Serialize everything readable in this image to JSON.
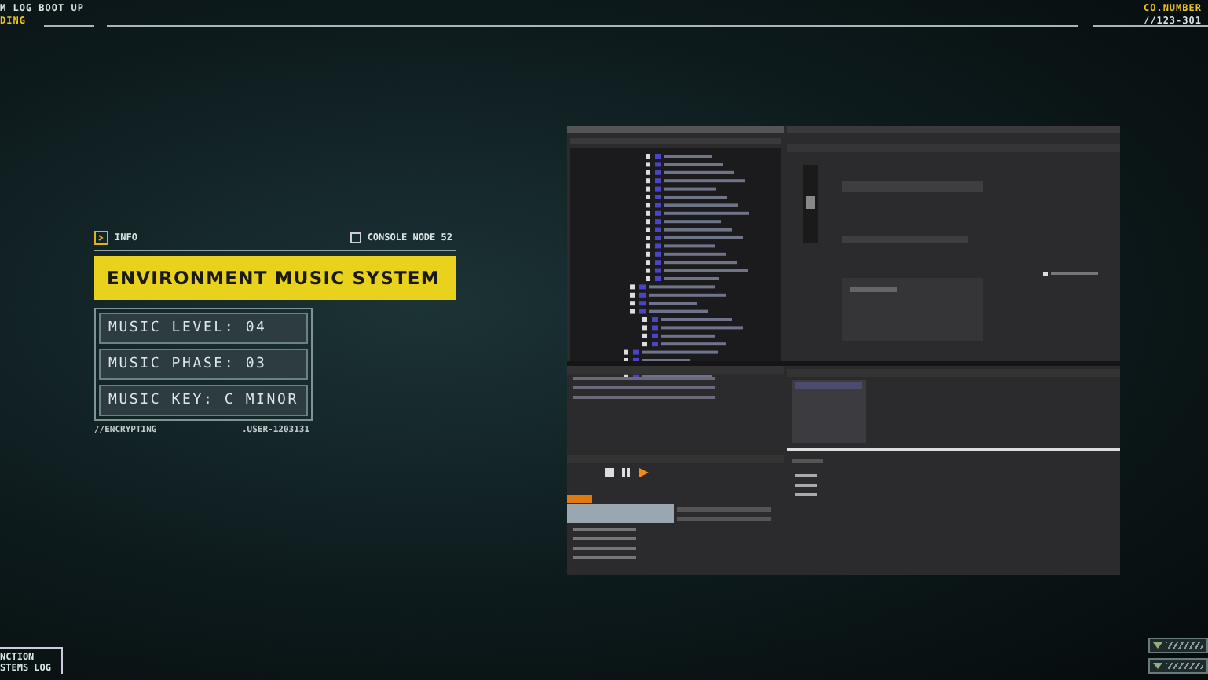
{
  "top_bar": {
    "left_lines": [
      "M LOG BOOT UP",
      "DING"
    ],
    "right_lines": [
      "CO.NUMBER",
      "//123-301"
    ]
  },
  "info_panel": {
    "tag": "INFO",
    "node": "CONSOLE NODE 52",
    "title": "ENVIRONMENT MUSIC SYSTEM",
    "rows": [
      "MUSIC LEVEL: 04",
      "MUSIC PHASE: 03",
      "MUSIC KEY: C MINOR"
    ],
    "footer_left": "//ENCRYPTING",
    "footer_right": ".USER-1203131"
  },
  "bottom_left": {
    "lines": [
      "NCTION",
      "STEMS LOG"
    ]
  }
}
